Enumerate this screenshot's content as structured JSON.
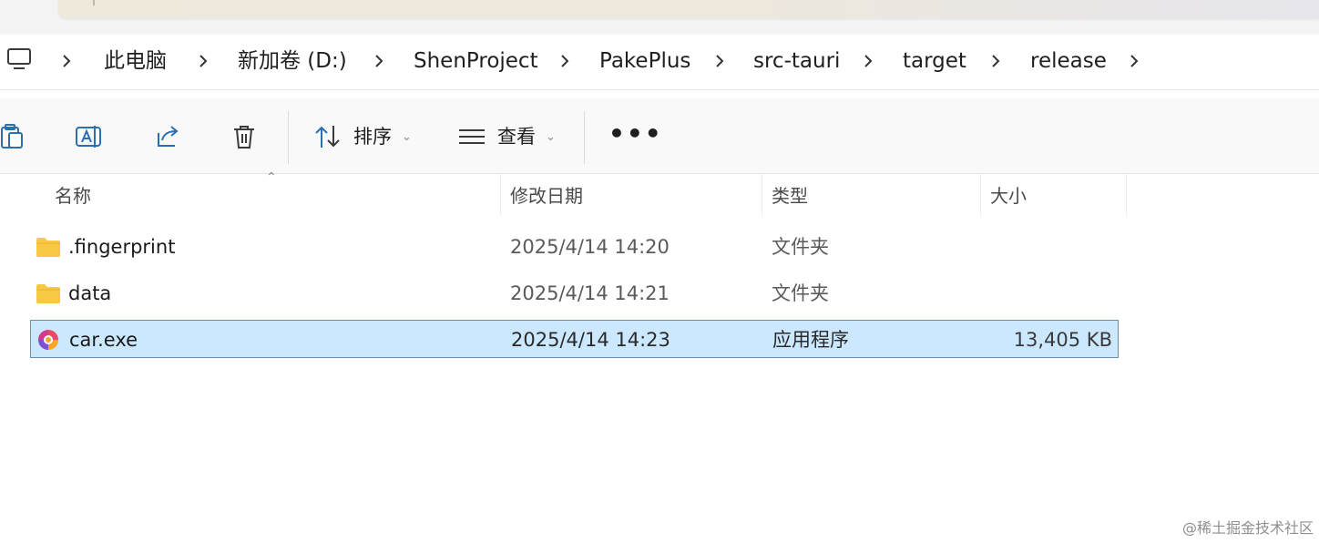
{
  "breadcrumb": {
    "items": [
      "此电脑",
      "新加卷 (D:)",
      "ShenProject",
      "PakePlus",
      "src-tauri",
      "target",
      "release"
    ]
  },
  "toolbar": {
    "sort_label": "排序",
    "view_label": "查看",
    "more_label": "•••"
  },
  "columns": {
    "name": "名称",
    "date": "修改日期",
    "type": "类型",
    "size": "大小"
  },
  "files": [
    {
      "name": ".fingerprint",
      "date": "2025/4/14 14:20",
      "type": "文件夹",
      "size": "",
      "icon": "folder-icon"
    },
    {
      "name": "data",
      "date": "2025/4/14 14:21",
      "type": "文件夹",
      "size": "",
      "icon": "folder-icon"
    },
    {
      "name": "car.exe",
      "date": "2025/4/14 14:23",
      "type": "应用程序",
      "size": "13,405 KB",
      "icon": "app-icon",
      "selected": true
    }
  ],
  "watermark": "@稀土掘金技术社区",
  "colors": {
    "selection_bg": "#cce8ff",
    "selection_border": "#6a8fb3",
    "folder": "#f8c845"
  }
}
